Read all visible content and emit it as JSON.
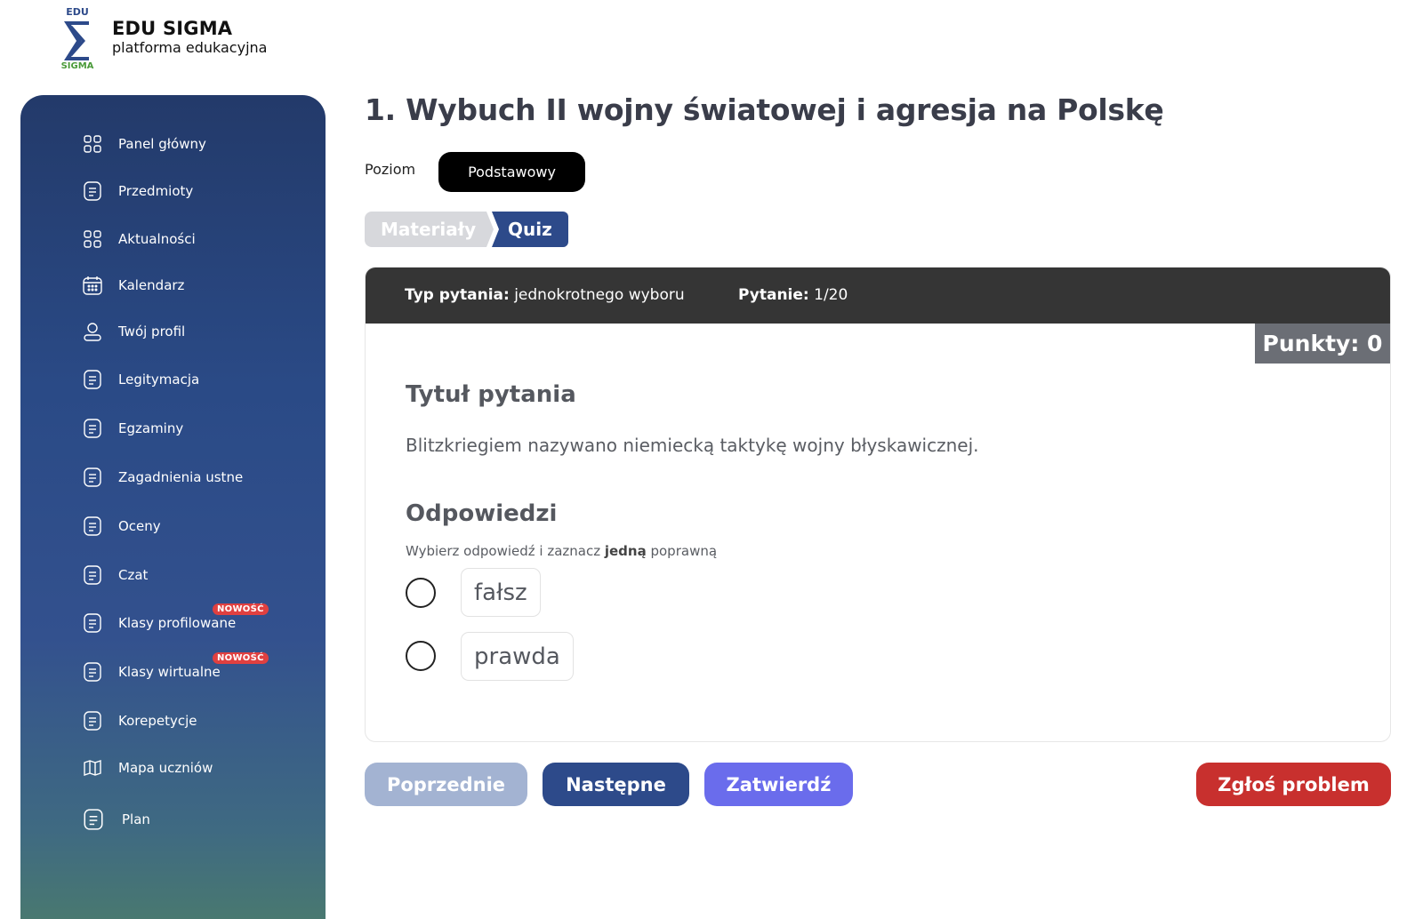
{
  "logo": {
    "brand": "EDU SIGMA",
    "tagline": "platforma edukacyjna",
    "mark_top_text": "EDU",
    "mark_bottom_text": "SIGMA"
  },
  "sidebar": {
    "items": [
      {
        "label": "Panel główny",
        "icon": "grid-icon"
      },
      {
        "label": "Przedmioty",
        "icon": "document-icon"
      },
      {
        "label": "Aktualności",
        "icon": "grid-icon"
      },
      {
        "label": "Kalendarz",
        "icon": "calendar-icon"
      },
      {
        "label": "Twój profil",
        "icon": "user-icon"
      },
      {
        "label": "Legitymacja",
        "icon": "document-icon"
      },
      {
        "label": "Egzaminy",
        "icon": "document-icon"
      },
      {
        "label": "Zagadnienia ustne",
        "icon": "document-icon"
      },
      {
        "label": "Oceny",
        "icon": "document-icon"
      },
      {
        "label": "Czat",
        "icon": "document-icon"
      },
      {
        "label": "Klasy profilowane",
        "icon": "document-icon",
        "badge": "NOWOŚĆ"
      },
      {
        "label": "Klasy wirtualne",
        "icon": "document-icon",
        "badge": "NOWOŚĆ"
      },
      {
        "label": "Korepetycje",
        "icon": "document-icon"
      },
      {
        "label": "Mapa uczniów",
        "icon": "map-icon"
      },
      {
        "label": "Plan",
        "icon": "document-icon"
      }
    ]
  },
  "main": {
    "title": "1. Wybuch II wojny światowej i agresja na Polskę",
    "level_label": "Poziom",
    "level_value": "Podstawowy",
    "tabs": [
      {
        "label": "Materiały",
        "active": false
      },
      {
        "label": "Quiz",
        "active": true
      }
    ]
  },
  "question": {
    "type_label": "Typ pytania:",
    "type_value": "jednokrotnego wyboru",
    "number_label": "Pytanie:",
    "number_value": "1/20",
    "points": "Punkty: 0",
    "title": "Tytuł pytania",
    "text": "Blitzkriegiem nazywano niemiecką taktykę wojny błyskawicznej.",
    "answers_title": "Odpowiedzi",
    "hint_before": "Wybierz odpowiedź i zaznacz ",
    "hint_bold": "jedną",
    "hint_after": " poprawną",
    "options": [
      {
        "label": "fałsz",
        "selected": false
      },
      {
        "label": "prawda",
        "selected": false
      }
    ]
  },
  "buttons": {
    "prev": "Poprzednie",
    "next": "Następne",
    "confirm": "Zatwierdź",
    "report": "Zgłoś problem"
  },
  "colors": {
    "primary": "#2d4a8a",
    "confirm": "#6a6cec",
    "danger": "#c8302e",
    "badge": "#e04040",
    "header_dark": "#353535"
  }
}
